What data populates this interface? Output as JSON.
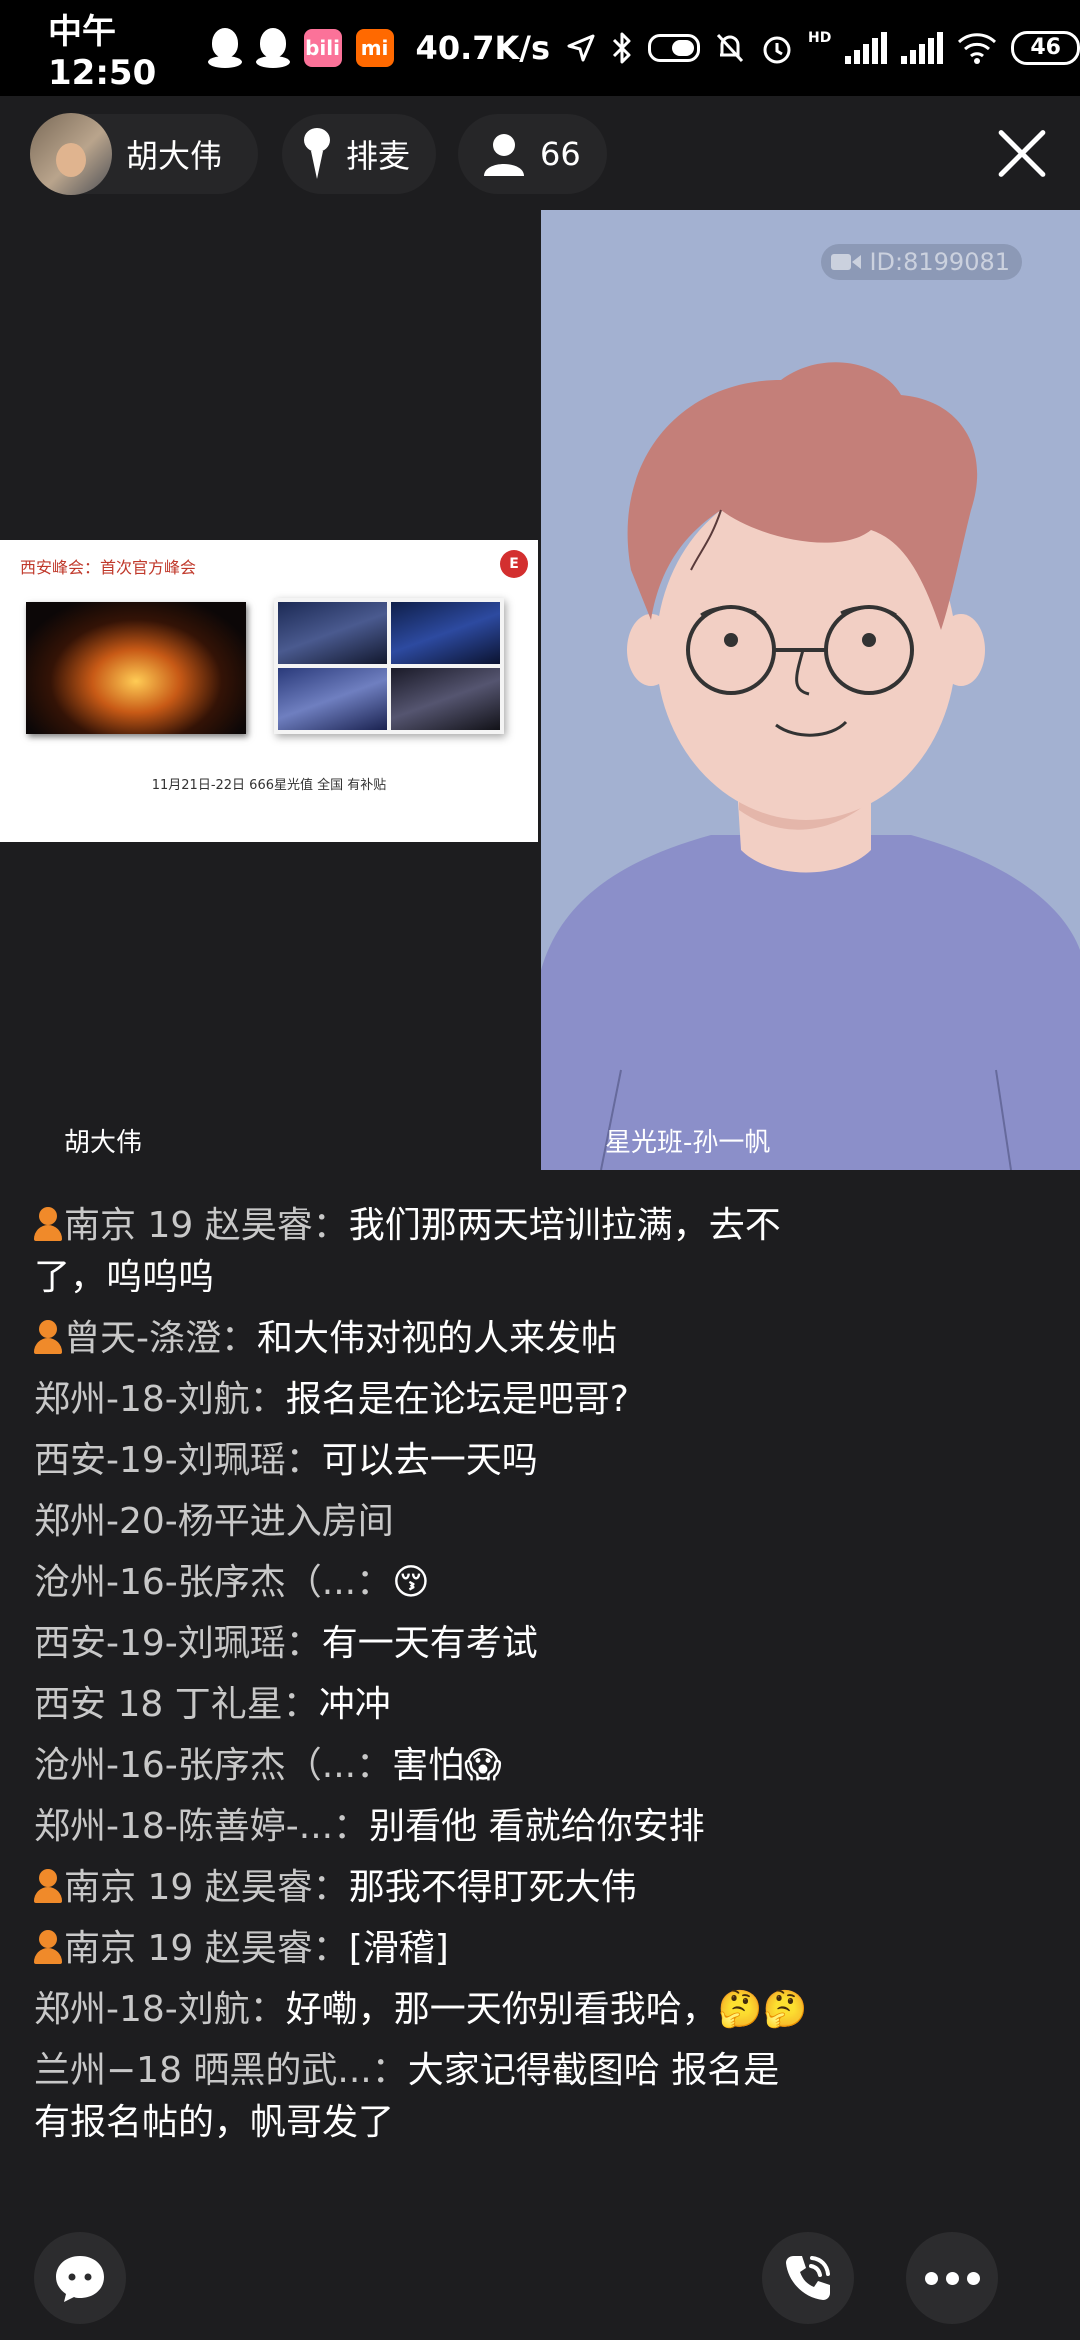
{
  "status_bar": {
    "time": "中午12:50",
    "network_speed": "40.7K/s",
    "hd_label": "HD",
    "battery": "46",
    "app_icons": [
      "qq-icon",
      "qq-icon",
      "bilibili-icon",
      "mi-icon"
    ],
    "bilibili_label": "bili",
    "mi_label": "mi"
  },
  "top_bar": {
    "host_name": "胡大伟",
    "mic_queue_label": "排麦",
    "viewer_count": "66"
  },
  "video": {
    "left_name": "胡大伟",
    "right_name": "星光班-孙一帆",
    "id_label": "ID:8199081",
    "slide": {
      "title": "西安峰会：首次官方峰会",
      "footer": "11月21日-22日    666星光值    全国    有补贴",
      "logo": "E"
    }
  },
  "chat": [
    {
      "vip": true,
      "nick": "南京 19 赵昊睿：",
      "text": "我们那两天培训拉满，去不了，呜呜呜"
    },
    {
      "vip": true,
      "nick": "曾天-涤澄：",
      "text": "和大伟对视的人来发帖"
    },
    {
      "vip": false,
      "nick": "郑州-18-刘航：",
      "text": "报名是在论坛是吧哥?"
    },
    {
      "vip": false,
      "nick": "西安-19-刘珮瑶：",
      "text": "可以去一天吗"
    },
    {
      "vip": false,
      "nick": "郑州-20-杨平进入房间",
      "text": ""
    },
    {
      "vip": false,
      "nick": "沧州-16-张序杰（...：",
      "text": "😚"
    },
    {
      "vip": false,
      "nick": "西安-19-刘珮瑶：",
      "text": "有一天有考试"
    },
    {
      "vip": false,
      "nick": "西安 18 丁礼星：",
      "text": "冲冲"
    },
    {
      "vip": false,
      "nick": "沧州-16-张序杰（...：",
      "text": "害怕😱"
    },
    {
      "vip": false,
      "nick": "郑州-18-陈善婷-...：",
      "text": "别看他 看就给你安排"
    },
    {
      "vip": true,
      "nick": "南京 19 赵昊睿：",
      "text": "那我不得盯死大伟"
    },
    {
      "vip": true,
      "nick": "南京 19 赵昊睿：",
      "text": "[滑稽]"
    },
    {
      "vip": false,
      "nick": "郑州-18-刘航：",
      "text": "好嘞，那一天你别看我哈，🤔🤔"
    },
    {
      "vip": false,
      "nick": "兰州−18 晒黑的武...：",
      "text": "大家记得截图哈  报名是有报名帖的，帆哥发了"
    }
  ],
  "bottom_bar": {
    "buttons": [
      "chat-bubble-icon",
      "phone-call-icon",
      "more-icon"
    ]
  }
}
